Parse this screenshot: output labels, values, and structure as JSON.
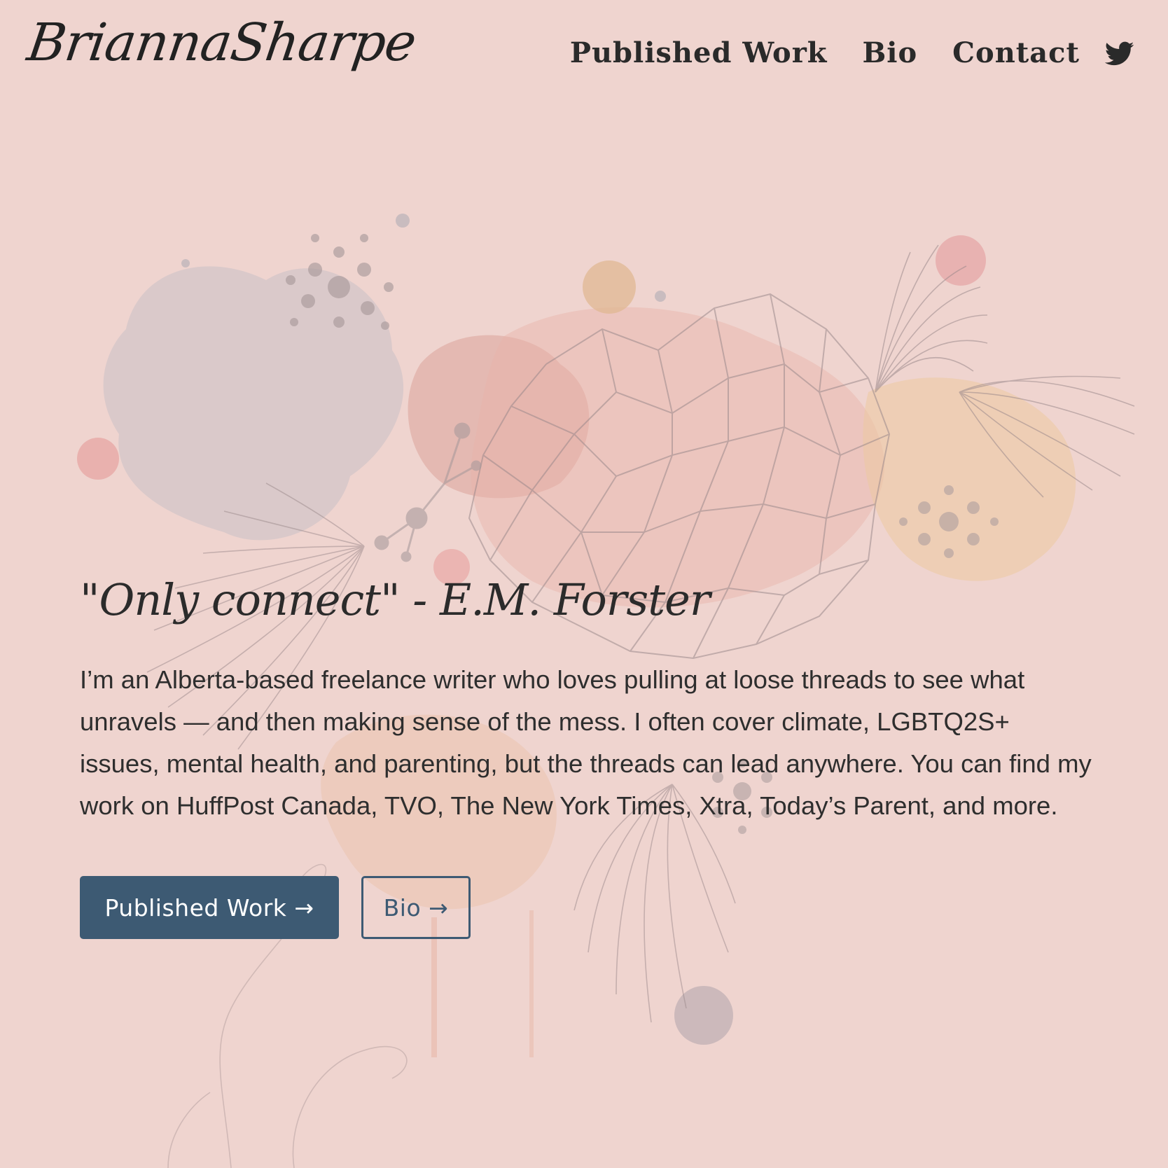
{
  "header": {
    "logo_text": "BriannaSharpe",
    "nav": {
      "published_work": "Published Work",
      "bio": "Bio",
      "contact": "Contact"
    },
    "social_icon": "twitter-icon"
  },
  "hero": {
    "quote": "\"Only connect\" - E.M. Forster",
    "intro": "I’m an Alberta-based freelance writer who loves pulling at loose threads to see what unravels — and then making sense of the mess. I often cover climate, LGBTQ2S+ issues, mental health, and parenting, but the threads can lead anywhere. You can find my work on HuffPost Canada, TVO, The New York Times, Xtra, Today’s Parent, and more.",
    "buttons": {
      "primary": "Published Work →",
      "secondary": "Bio →"
    }
  },
  "colors": {
    "background": "#efd4cf",
    "accent": "#3d5a73",
    "text": "#2b2b2b"
  }
}
